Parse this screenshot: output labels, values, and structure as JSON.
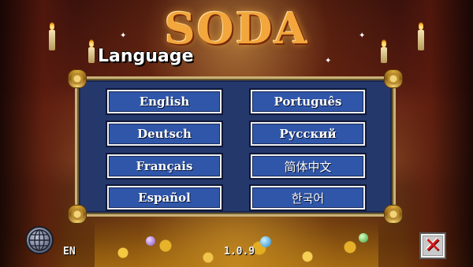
{
  "game": {
    "logo_text": "SODA"
  },
  "dialog": {
    "title": "Language",
    "languages": [
      {
        "label": "English"
      },
      {
        "label": "Português"
      },
      {
        "label": "Deutsch"
      },
      {
        "label": "Русский"
      },
      {
        "label": "Français"
      },
      {
        "label": "简体中文"
      },
      {
        "label": "Español"
      },
      {
        "label": "한국어"
      }
    ]
  },
  "footer": {
    "current_language_code": "EN",
    "version": "1.0.9",
    "globe_icon": "globe-icon",
    "close_icon": "close-icon",
    "close_glyph": "✕"
  },
  "colors": {
    "panel_bg": "#25386c",
    "button_bg": "#2f56a8",
    "panel_border": "#c9b178",
    "close_x": "#d21a1a"
  }
}
